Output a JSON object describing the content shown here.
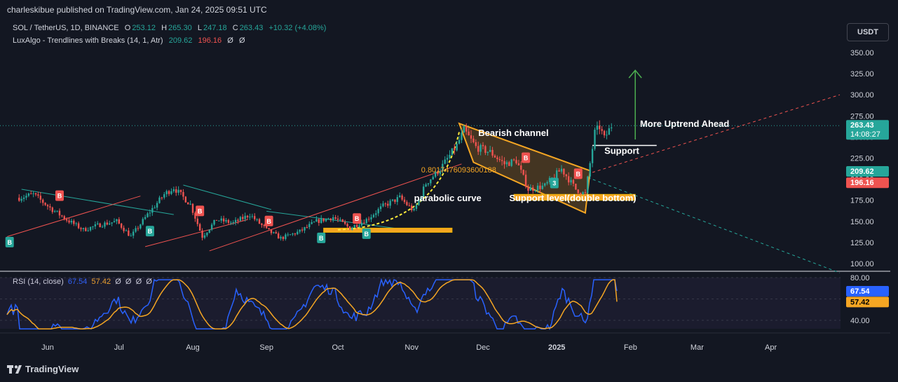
{
  "header": {
    "published_by": "charleskibue published on TradingView.com, Jan 24, 2025 09:51 UTC"
  },
  "legend": {
    "symbol": "SOL / TetherUS, 1D, BINANCE",
    "o_label": "O",
    "o": "253.12",
    "h_label": "H",
    "h": "265.30",
    "l_label": "L",
    "l": "247.18",
    "c_label": "C",
    "c": "263.43",
    "change": "+10.32 (+4.08%)",
    "indicator": "LuxAlgo - Trendlines with Breaks (14, 1, Atr)",
    "ind_v1": "209.62",
    "ind_v2": "196.16",
    "ind_v3": "Ø",
    "ind_v4": "Ø"
  },
  "currency_button": "USDT",
  "rsi_legend": {
    "name": "RSI (14, close)",
    "rsi": "67.54",
    "ma": "57.42",
    "extra": [
      "Ø",
      "Ø",
      "Ø",
      "Ø"
    ]
  },
  "footer": {
    "brand": "TradingView"
  },
  "colors": {
    "bg": "#131722",
    "up": "#26a69a",
    "down": "#ef5350",
    "rsi": "#2962ff",
    "rsi_ma": "#f5a623",
    "annot": "#f5a623"
  },
  "chart_data": [
    {
      "type": "candlestick",
      "title": "SOL / TetherUS, 1D, BINANCE",
      "x_ticks": [
        "Jun",
        "Jul",
        "Aug",
        "Sep",
        "Oct",
        "Nov",
        "Dec",
        "2025",
        "Feb",
        "Mar",
        "Apr"
      ],
      "y_ticks": [
        100,
        125,
        150,
        175,
        200,
        225,
        250,
        275,
        300,
        325,
        350
      ],
      "y_tick_labels": [
        "100.00",
        "125.00",
        "150.00",
        "175.00",
        "200.00",
        "225.00",
        "250.00",
        "275.00",
        "300.00",
        "325.00",
        "350.00"
      ],
      "ylim": [
        88,
        370
      ],
      "price_labels": [
        {
          "value": 263.43,
          "text": "263.43",
          "sub": "14:08:27",
          "color": "#26a69a"
        },
        {
          "value": 209.62,
          "text": "209.62",
          "color": "#26a69a"
        },
        {
          "value": 196.16,
          "text": "196.16",
          "color": "#ef5350"
        }
      ],
      "series_close": [
        {
          "date": "2024-05-20",
          "close": 178
        },
        {
          "date": "2024-05-26",
          "close": 182
        },
        {
          "date": "2024-06-02",
          "close": 166
        },
        {
          "date": "2024-06-09",
          "close": 152
        },
        {
          "date": "2024-06-16",
          "close": 140
        },
        {
          "date": "2024-06-23",
          "close": 146
        },
        {
          "date": "2024-06-30",
          "close": 150
        },
        {
          "date": "2024-07-06",
          "close": 132
        },
        {
          "date": "2024-07-13",
          "close": 158
        },
        {
          "date": "2024-07-20",
          "close": 182
        },
        {
          "date": "2024-07-24",
          "close": 190
        },
        {
          "date": "2024-07-31",
          "close": 170
        },
        {
          "date": "2024-08-05",
          "close": 132
        },
        {
          "date": "2024-08-11",
          "close": 152
        },
        {
          "date": "2024-08-18",
          "close": 148
        },
        {
          "date": "2024-08-25",
          "close": 158
        },
        {
          "date": "2024-09-01",
          "close": 140
        },
        {
          "date": "2024-09-07",
          "close": 130
        },
        {
          "date": "2024-09-15",
          "close": 138
        },
        {
          "date": "2024-09-22",
          "close": 150
        },
        {
          "date": "2024-09-29",
          "close": 155
        },
        {
          "date": "2024-10-06",
          "close": 142
        },
        {
          "date": "2024-10-13",
          "close": 152
        },
        {
          "date": "2024-10-20",
          "close": 168
        },
        {
          "date": "2024-10-27",
          "close": 178
        },
        {
          "date": "2024-11-02",
          "close": 162
        },
        {
          "date": "2024-11-07",
          "close": 195
        },
        {
          "date": "2024-11-13",
          "close": 212
        },
        {
          "date": "2024-11-20",
          "close": 240
        },
        {
          "date": "2024-11-23",
          "close": 258
        },
        {
          "date": "2024-11-28",
          "close": 238
        },
        {
          "date": "2024-12-04",
          "close": 232
        },
        {
          "date": "2024-12-10",
          "close": 218
        },
        {
          "date": "2024-12-15",
          "close": 222
        },
        {
          "date": "2024-12-20",
          "close": 188
        },
        {
          "date": "2024-12-27",
          "close": 192
        },
        {
          "date": "2025-01-03",
          "close": 212
        },
        {
          "date": "2025-01-09",
          "close": 188
        },
        {
          "date": "2025-01-13",
          "close": 182
        },
        {
          "date": "2025-01-17",
          "close": 255
        },
        {
          "date": "2025-01-19",
          "close": 262
        },
        {
          "date": "2025-01-21",
          "close": 248
        },
        {
          "date": "2025-01-24",
          "close": 263.43
        }
      ],
      "annotations": [
        {
          "text": "Bearish channel"
        },
        {
          "text": "parabolic curve"
        },
        {
          "text": "Support level(double bottom)"
        },
        {
          "text": "Support"
        },
        {
          "text": "More Uptrend Ahead"
        },
        {
          "text": "0.8017476093600188"
        }
      ],
      "breakout_markers": {
        "B_labels": "B",
        "channel_marker": "3"
      }
    },
    {
      "type": "line",
      "title": "RSI (14, close)",
      "y_ticks": [
        40,
        80
      ],
      "y_tick_labels": [
        "40.00",
        "80.00"
      ],
      "ylim": [
        30,
        85
      ],
      "series": [
        {
          "name": "RSI",
          "color": "#2962ff",
          "last": 67.54
        },
        {
          "name": "RSI MA",
          "color": "#f5a623",
          "last": 57.42
        }
      ],
      "value_labels": [
        "67.54",
        "57.42"
      ]
    }
  ]
}
